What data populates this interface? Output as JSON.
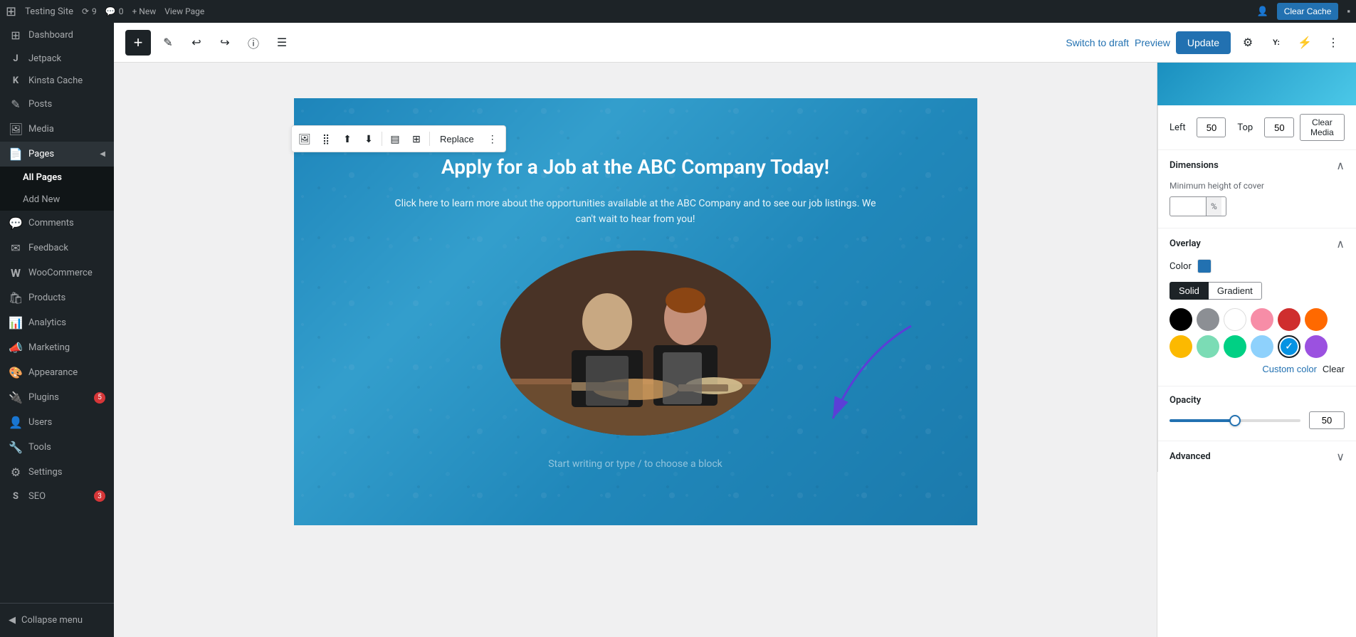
{
  "topbar": {
    "wp_logo": "⊞",
    "site_name": "Testing Site",
    "updates_count": "9",
    "comments_count": "0",
    "new_label": "+ New",
    "view_page_label": "View Page",
    "clear_cache_label": "Clear Cache"
  },
  "sidebar": {
    "items": [
      {
        "id": "dashboard",
        "label": "Dashboard",
        "icon": "⊞"
      },
      {
        "id": "jetpack",
        "label": "Jetpack",
        "icon": "J"
      },
      {
        "id": "kinsta-cache",
        "label": "Kinsta Cache",
        "icon": "K"
      },
      {
        "id": "posts",
        "label": "Posts",
        "icon": "✎"
      },
      {
        "id": "media",
        "label": "Media",
        "icon": "🖼"
      },
      {
        "id": "pages",
        "label": "Pages",
        "icon": "📄"
      },
      {
        "id": "comments",
        "label": "Comments",
        "icon": "💬"
      },
      {
        "id": "feedback",
        "label": "Feedback",
        "icon": "✉"
      },
      {
        "id": "woocommerce",
        "label": "WooCommerce",
        "icon": "W"
      },
      {
        "id": "products",
        "label": "Products",
        "icon": "🛍"
      },
      {
        "id": "analytics",
        "label": "Analytics",
        "icon": "📊"
      },
      {
        "id": "marketing",
        "label": "Marketing",
        "icon": "📣"
      },
      {
        "id": "appearance",
        "label": "Appearance",
        "icon": "🎨"
      },
      {
        "id": "plugins",
        "label": "Plugins",
        "icon": "🔌",
        "badge": "5"
      },
      {
        "id": "users",
        "label": "Users",
        "icon": "👤"
      },
      {
        "id": "tools",
        "label": "Tools",
        "icon": "🔧"
      },
      {
        "id": "settings",
        "label": "Settings",
        "icon": "⚙"
      },
      {
        "id": "seo",
        "label": "SEO",
        "icon": "S",
        "badge": "3"
      }
    ],
    "pages_submenu": [
      {
        "id": "all-pages",
        "label": "All Pages",
        "active": true
      },
      {
        "id": "add-new",
        "label": "Add New"
      }
    ],
    "collapse_label": "Collapse menu"
  },
  "editor": {
    "toolbar": {
      "add_label": "+",
      "switch_draft_label": "Switch to draft",
      "preview_label": "Preview",
      "update_label": "Update"
    },
    "block_toolbar": {
      "replace_label": "Replace"
    },
    "cover": {
      "title": "Apply for a Job at the ABC Company Today!",
      "description": "Click here to learn more about the opportunities available at the ABC Company and to see our job listings. We can't wait to hear from you!",
      "placeholder_text": "Start writing or type / to choose a block"
    }
  },
  "right_panel": {
    "position": {
      "left_label": "Left",
      "left_value": "50",
      "left_unit": "%",
      "top_label": "Top",
      "top_value": "50",
      "top_unit": "%",
      "clear_media_label": "Clear Media"
    },
    "dimensions": {
      "title": "Dimensions",
      "min_height_label": "Minimum height of cover",
      "min_height_value": "",
      "min_height_unit": "%"
    },
    "overlay": {
      "title": "Overlay",
      "color_label": "Color",
      "color_hex": "#2271b1",
      "type_solid": "Solid",
      "type_gradient": "Gradient",
      "active_type": "Solid",
      "colors": [
        {
          "id": "black",
          "hex": "#000000",
          "name": "Black"
        },
        {
          "id": "gray",
          "hex": "#8c8f94",
          "name": "Gray"
        },
        {
          "id": "white",
          "hex": "#ffffff",
          "name": "White",
          "light": true
        },
        {
          "id": "pink",
          "hex": "#f78da7",
          "name": "Pink",
          "light": true
        },
        {
          "id": "red",
          "hex": "#cf2e2e",
          "name": "Red"
        },
        {
          "id": "orange",
          "hex": "#ff6900",
          "name": "Orange"
        },
        {
          "id": "yellow",
          "hex": "#fcb900",
          "name": "Yellow",
          "light": true
        },
        {
          "id": "light-green",
          "hex": "#7bdcb5",
          "name": "Light Green",
          "light": true
        },
        {
          "id": "green",
          "hex": "#00d084",
          "name": "Green"
        },
        {
          "id": "light-blue",
          "hex": "#8ed1fc",
          "name": "Light Blue",
          "light": true
        },
        {
          "id": "cyan",
          "hex": "#0693e3",
          "name": "Cyan",
          "selected": true
        },
        {
          "id": "purple",
          "hex": "#9b51e0",
          "name": "Purple"
        }
      ],
      "custom_color_label": "Custom color",
      "clear_label": "Clear"
    },
    "opacity": {
      "title": "Opacity",
      "value": "50",
      "slider_percent": 50
    },
    "advanced": {
      "title": "Advanced"
    }
  }
}
